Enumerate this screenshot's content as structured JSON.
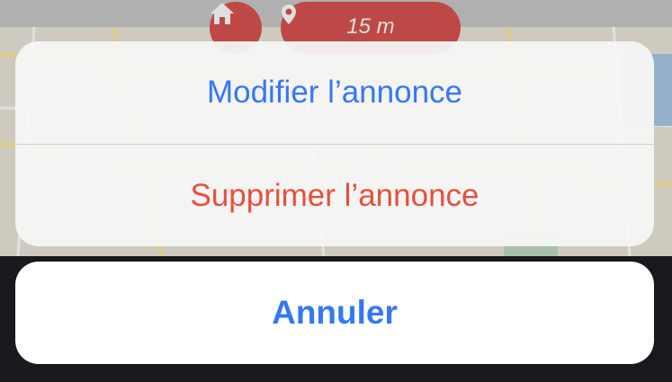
{
  "map": {
    "distance_label": "15 m",
    "home_icon": "home-icon",
    "pin_icon": "map-pin-icon",
    "accent_color": "#d9534f"
  },
  "action_sheet": {
    "modify_label": "Modifier l’annonce",
    "delete_label": "Supprimer l’annonce",
    "cancel_label": "Annuler",
    "modify_color": "#3478f6",
    "delete_color": "#e5503e"
  }
}
